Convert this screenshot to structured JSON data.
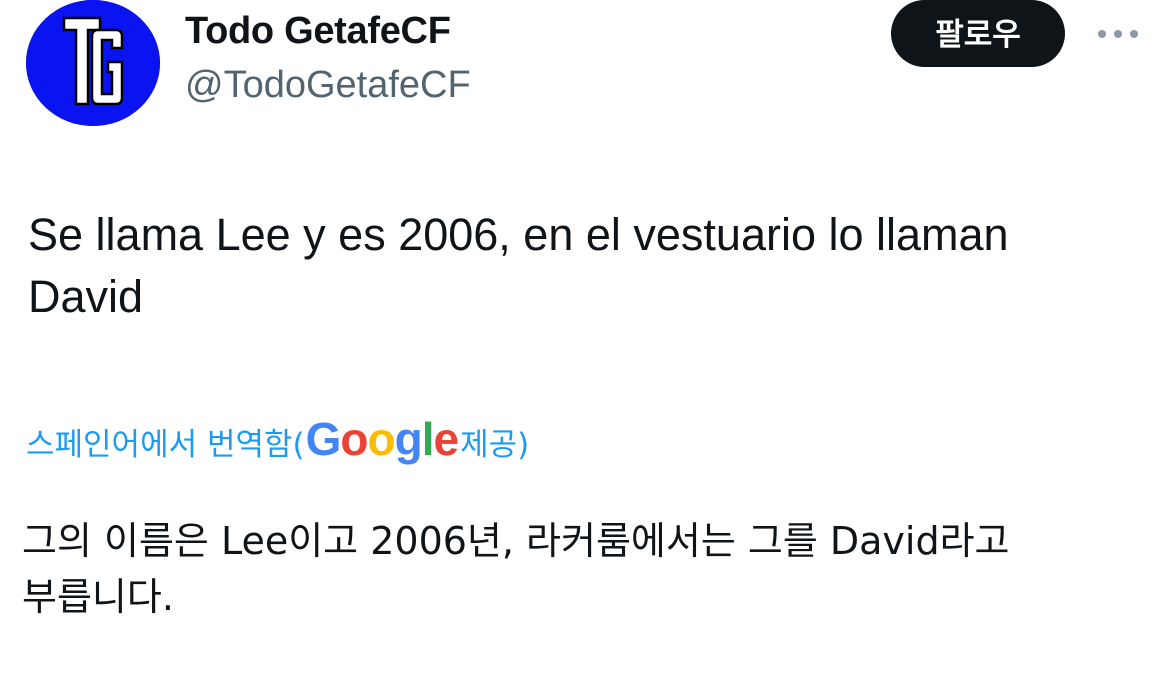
{
  "author": {
    "name": "Todo GetafeCF",
    "handle": "@TodoGetafeCF",
    "avatar_initials": "TG",
    "avatar_color": "#0a14f0"
  },
  "actions": {
    "follow_label": "팔로우",
    "more_icon": "more-horizontal-icon"
  },
  "tweet": {
    "text": "Se llama Lee y es 2006, en el vestuario lo llaman\nDavid"
  },
  "translation": {
    "prefix": "스페인어에서 번역함(",
    "google_logo": {
      "G": "G",
      "o1": "o",
      "o2": "o",
      "g": "g",
      "l": "l",
      "e": "e"
    },
    "suffix": " 제공)",
    "text": "그의 이름은 Lee이고 2006년, 라커룸에서는 그를 David라고\n부릅니다.",
    "link_color": "#1d9bf0"
  }
}
